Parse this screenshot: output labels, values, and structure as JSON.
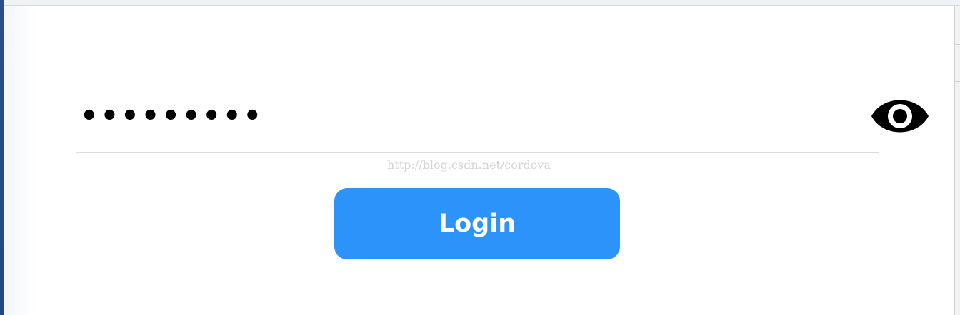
{
  "form": {
    "password_value": "•••••••••",
    "password_label": "",
    "toggle_icon": "eye-icon",
    "login_label": "Login"
  },
  "watermark": {
    "text": "http://blog.csdn.net/cordova"
  },
  "colors": {
    "accent": "#2c93fb",
    "text": "#000000",
    "divider": "#dcdcdc",
    "watermark": "#d3d3d3",
    "left_edge": "#23477f"
  }
}
